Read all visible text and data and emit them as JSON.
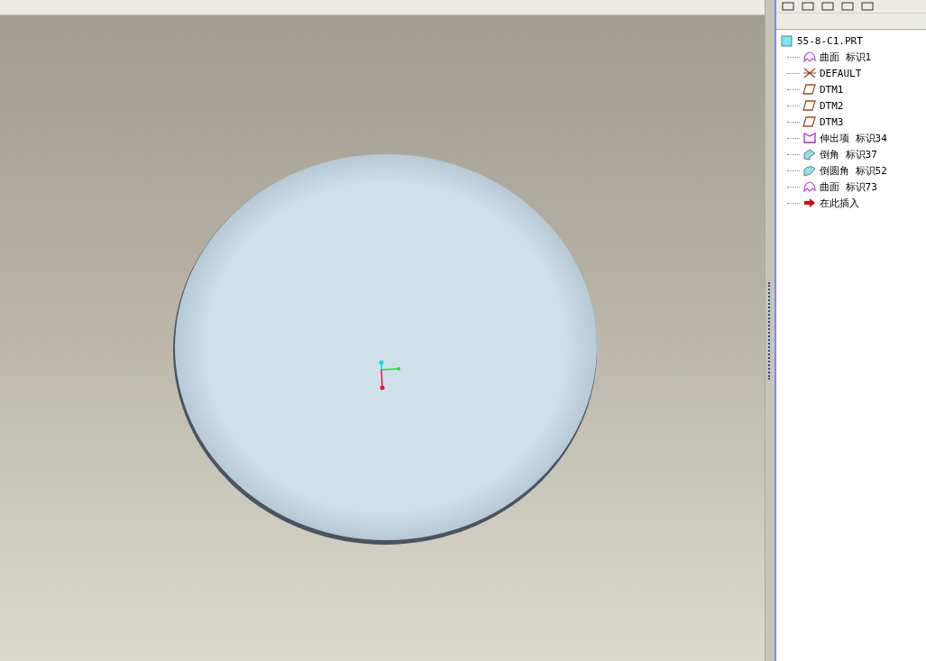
{
  "model_tree": {
    "label": "55-8-C1.PRT",
    "children": [
      {
        "kind": "surface",
        "label": "曲面 标识1"
      },
      {
        "kind": "csys",
        "label": "DEFAULT"
      },
      {
        "kind": "plane",
        "label": "DTM1"
      },
      {
        "kind": "plane",
        "label": "DTM2"
      },
      {
        "kind": "plane",
        "label": "DTM3"
      },
      {
        "kind": "protrusion",
        "label": "伸出项 标识34"
      },
      {
        "kind": "chamfer",
        "label": "倒角 标识37"
      },
      {
        "kind": "round",
        "label": "倒圆角 标识52"
      },
      {
        "kind": "surface",
        "label": "曲面 标识73"
      },
      {
        "kind": "insert",
        "label": "在此插入"
      }
    ]
  }
}
